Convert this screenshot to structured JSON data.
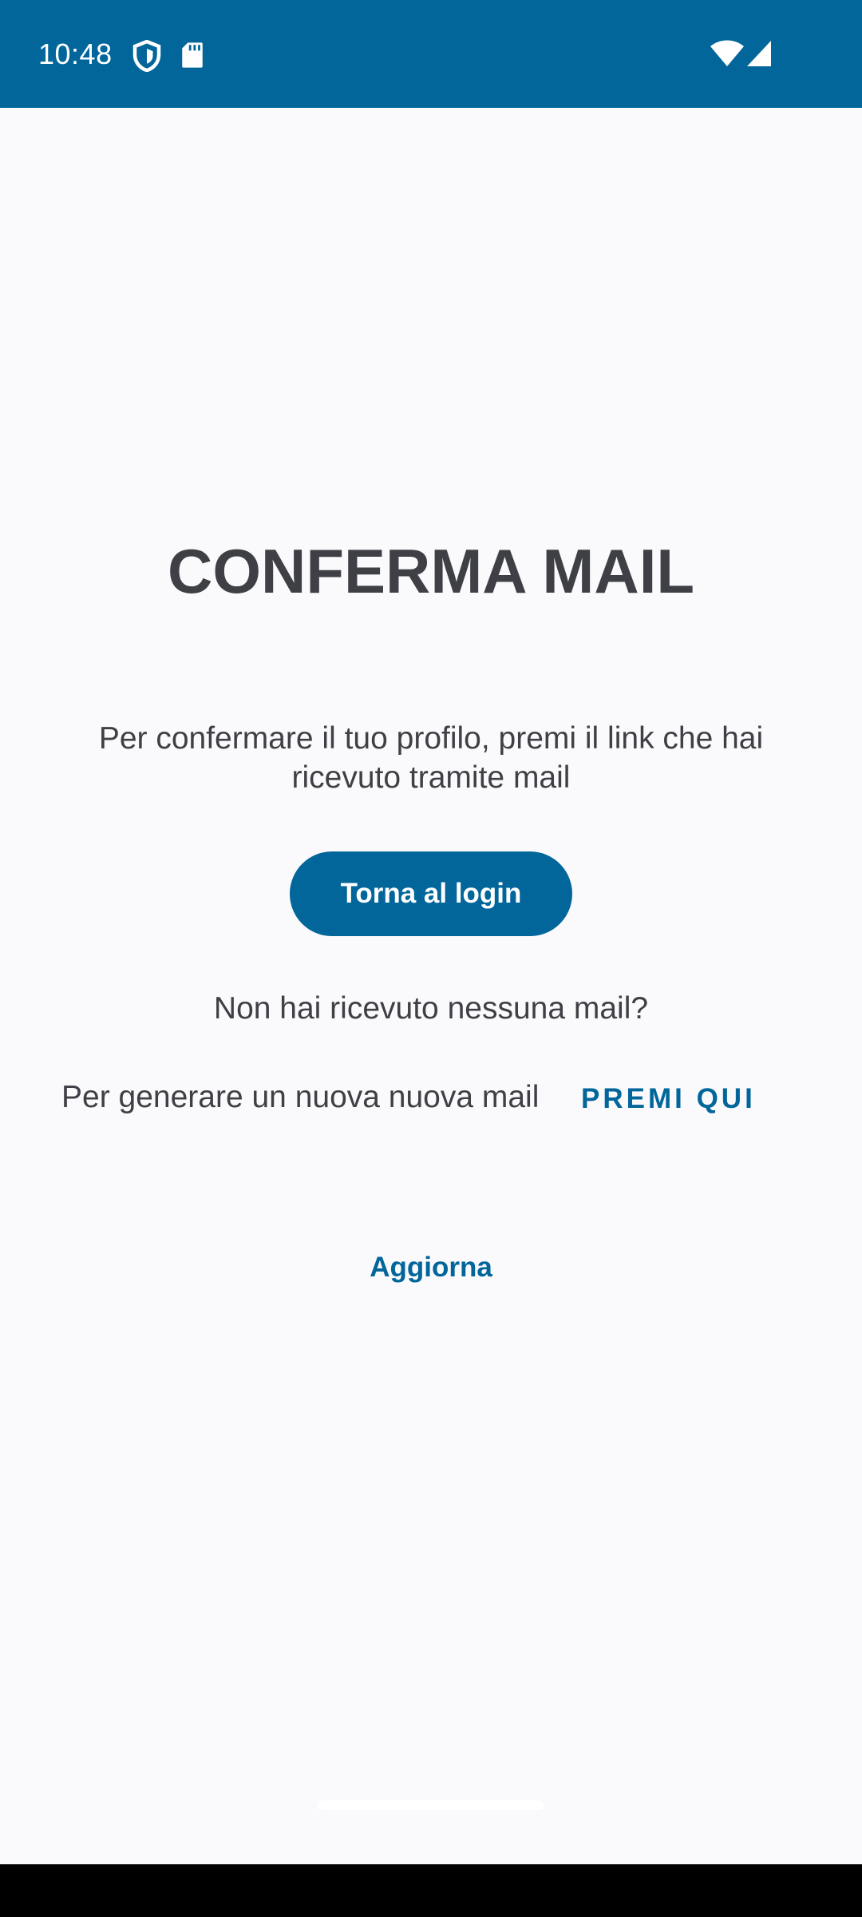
{
  "status_bar": {
    "time": "10:48",
    "icons": [
      "shield-icon",
      "sd-card-icon",
      "wifi-icon",
      "cellular-signal-icon"
    ],
    "background_color": "#02669a"
  },
  "screen": {
    "title": "CONFERMA MAIL",
    "message": "Per confermare il tuo profilo, premi il link che hai ricevuto tramite mail",
    "login_button_label": "Torna al login",
    "no_mail_question": "Non hai ricevuto nessuna mail?",
    "generate_text": "Per generare un nuova nuova mail",
    "press_here_label": "PREMI QUI",
    "refresh_label": "Aggiorna"
  },
  "colors": {
    "accent": "#02669a",
    "text": "#3f3f46",
    "background": "#fafafc"
  }
}
